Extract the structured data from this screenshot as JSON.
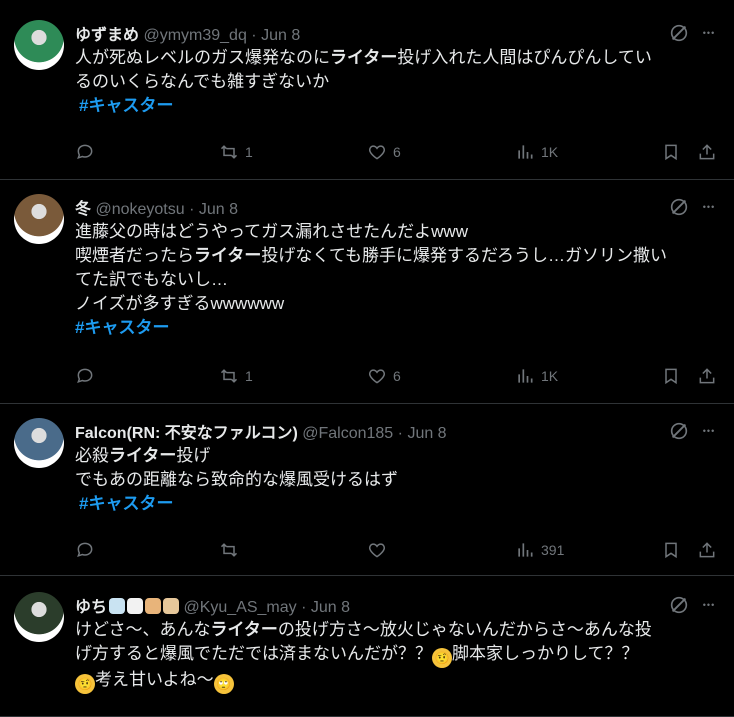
{
  "tweets": [
    {
      "name": "ゆずまめ",
      "handle": "@ymym39_dq",
      "sep": "·",
      "date": "Jun 8",
      "lines": [
        [
          {
            "t": "人が死ぬレベルのガス爆発なのに"
          },
          {
            "t": "ライター",
            "b": true
          },
          {
            "t": "投げ入れた人間はぴんぴんしてい"
          }
        ],
        [
          {
            "t": "るのいくらなんでも雑すぎないか"
          }
        ]
      ],
      "hashtag": "#キャスター",
      "reply": "",
      "retweet": "1",
      "like": "6",
      "views": "1K",
      "avatar_color": "#2e8b57"
    },
    {
      "name": "冬",
      "handle": "@nokeyotsu",
      "sep": "·",
      "date": "Jun 8",
      "lines": [
        [
          {
            "t": "進藤父の時はどうやってガス漏れさせたんだよwww"
          }
        ],
        [
          {
            "t": "喫煙者だったら"
          },
          {
            "t": "ライター",
            "b": true
          },
          {
            "t": "投げなくても勝手に爆発するだろうし…ガソリン撒い"
          }
        ],
        [
          {
            "t": "てた訳でもないし…"
          }
        ],
        [
          {
            "t": "ノイズが多すぎるwwwwww"
          }
        ]
      ],
      "hashtag": "#キャスター",
      "reply": "",
      "retweet": "1",
      "like": "6",
      "views": "1K",
      "avatar_color": "#7a5a3a"
    },
    {
      "name": "Falcon(RN: 不安なファルコン)",
      "handle": "@Falcon185",
      "sep": "·",
      "date": "Jun 8",
      "lines": [
        [
          {
            "t": "必殺"
          },
          {
            "t": "ライター",
            "b": true
          },
          {
            "t": "投げ"
          }
        ],
        [
          {
            "t": "でもあの距離なら致命的な爆風受けるはず"
          }
        ]
      ],
      "hashtag": "#キャスター",
      "reply": "",
      "retweet": "",
      "like": "",
      "views": "391",
      "avatar_color": "#4a6b8a"
    },
    {
      "name": "ゆち",
      "handle": "@Kyu_AS_may",
      "sep": "·",
      "date": "Jun 8",
      "lines": [
        [
          {
            "t": "けどさ〜、あんな"
          },
          {
            "t": "ライター",
            "b": true
          },
          {
            "t": "の投げ方さ〜放火じゃないんだからさ〜あんな投"
          }
        ],
        [
          {
            "t": "げ方すると爆風でただでは済まないんだが？？"
          },
          {
            "e": "🤨"
          },
          {
            "t": "脚本家しっかりして？？"
          }
        ],
        [
          {
            "e": "🤨"
          },
          {
            "t": "考え甘いよね〜"
          },
          {
            "e": "🙄"
          }
        ]
      ],
      "hashtag": "",
      "avatar_color": "#2b3d2b"
    }
  ]
}
